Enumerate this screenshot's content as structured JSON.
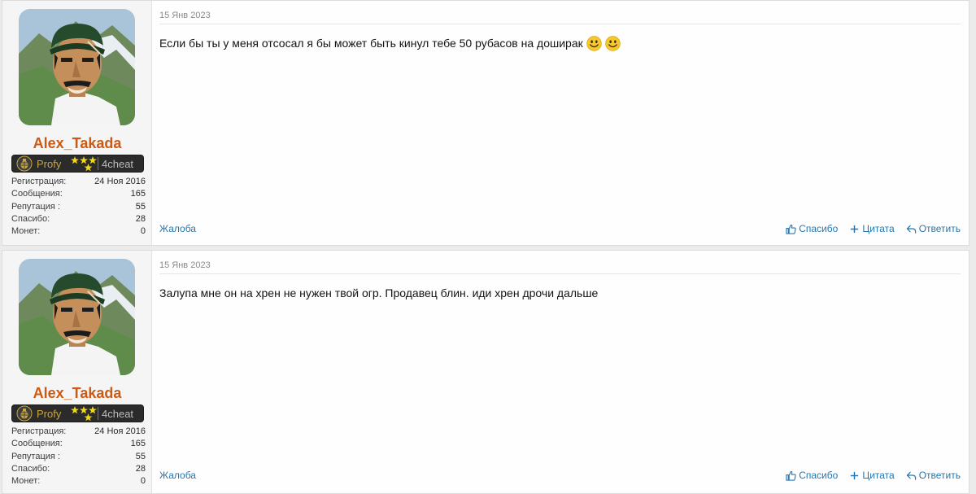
{
  "posts": [
    {
      "date": "15 Янв 2023",
      "author": "Alex_Takada",
      "banner": {
        "rank": "Profy",
        "site": "4cheat"
      },
      "stats": [
        {
          "label": "Регистрация:",
          "value": "24 Ноя 2016"
        },
        {
          "label": "Сообщения:",
          "value": "165"
        },
        {
          "label": "Репутация :",
          "value": "55"
        },
        {
          "label": "Спасибо:",
          "value": "28"
        },
        {
          "label": "Монет:",
          "value": "0"
        }
      ],
      "text": "Если бы ты у меня отсосал я бы может быть кинул тебе 50 рубасов на доширак",
      "report": "Жалоба",
      "actions": {
        "like": "Спасибо",
        "quote": "Цитата",
        "reply": "Ответить"
      }
    },
    {
      "date": "15 Янв 2023",
      "author": "Alex_Takada",
      "banner": {
        "rank": "Profy",
        "site": "4cheat"
      },
      "stats": [
        {
          "label": "Регистрация:",
          "value": "24 Ноя 2016"
        },
        {
          "label": "Сообщения:",
          "value": "165"
        },
        {
          "label": "Репутация :",
          "value": "55"
        },
        {
          "label": "Спасибо:",
          "value": "28"
        },
        {
          "label": "Монет:",
          "value": "0"
        }
      ],
      "text": "Залупа мне он на хрен не нужен твой огр. Продавец блин. иди хрен дрочи дальше",
      "report": "Жалоба",
      "actions": {
        "like": "Спасибо",
        "quote": "Цитата",
        "reply": "Ответить"
      }
    }
  ],
  "icons": {
    "avatar": "avatar-portrait",
    "banner_emblem": "grenade-icon",
    "smile": "smile-emoji-icon",
    "like": "thumbs-up-icon",
    "quote": "plus-icon",
    "reply": "reply-arrow-icon"
  },
  "colors": {
    "username": "#cc5a12",
    "link": "#2577b1",
    "banner_bg": "#2b2b2b",
    "rank": "#c9a640"
  }
}
